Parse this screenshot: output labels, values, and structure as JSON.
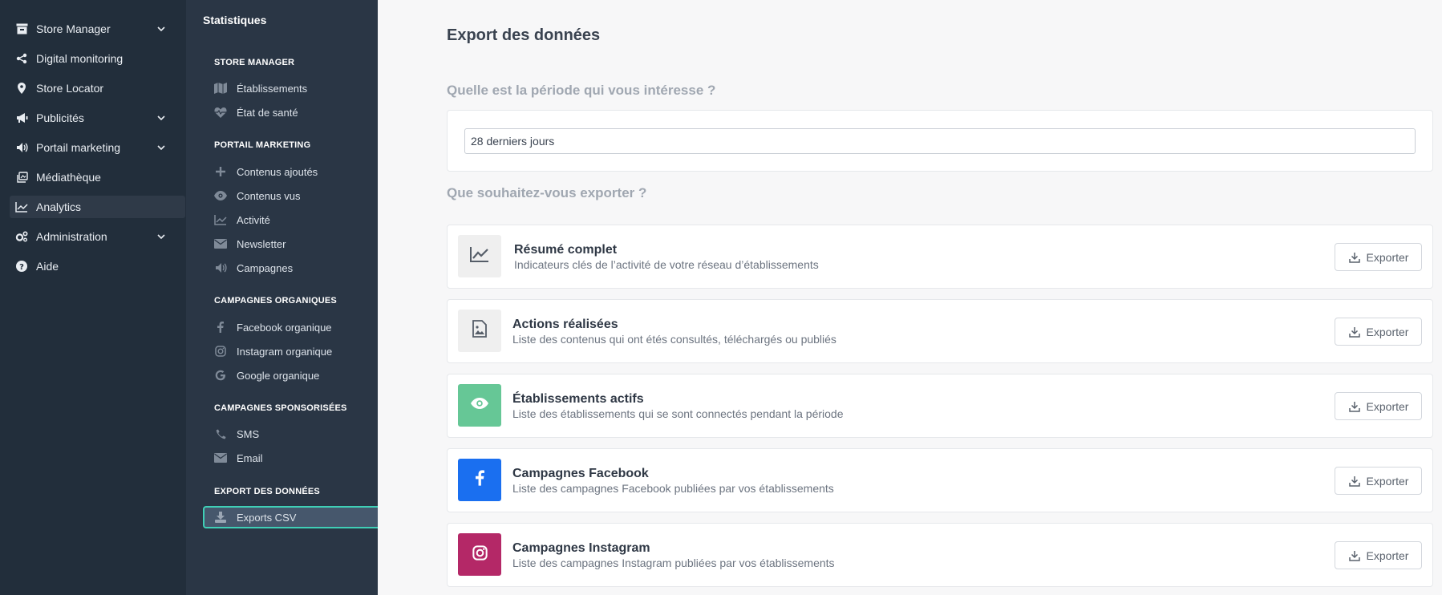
{
  "nav_main": {
    "items": [
      {
        "label": "Store Manager",
        "icon": "store-icon",
        "has_chevron": true
      },
      {
        "label": "Digital monitoring",
        "icon": "share-icon",
        "has_chevron": false
      },
      {
        "label": "Store Locator",
        "icon": "map-pin-icon",
        "has_chevron": false
      },
      {
        "label": "Publicités",
        "icon": "bullhorn-icon",
        "has_chevron": true
      },
      {
        "label": "Portail marketing",
        "icon": "volume-icon",
        "has_chevron": true
      },
      {
        "label": "Médiathèque",
        "icon": "media-icon",
        "has_chevron": false
      },
      {
        "label": "Analytics",
        "icon": "chart-line-icon",
        "has_chevron": false,
        "active": true
      },
      {
        "label": "Administration",
        "icon": "cogs-icon",
        "has_chevron": true
      },
      {
        "label": "Aide",
        "icon": "question-circle-icon",
        "has_chevron": false
      }
    ]
  },
  "nav_stats": {
    "title": "Statistiques",
    "sections": [
      {
        "label": "STORE MANAGER",
        "items": [
          {
            "label": "Établissements",
            "icon": "map-icon"
          },
          {
            "label": "État de santé",
            "icon": "heartbeat-icon"
          }
        ]
      },
      {
        "label": "PORTAIL MARKETING",
        "items": [
          {
            "label": "Contenus ajoutés",
            "icon": "plus-icon"
          },
          {
            "label": "Contenus vus",
            "icon": "eye-icon"
          },
          {
            "label": "Activité",
            "icon": "chart-line-icon"
          },
          {
            "label": "Newsletter",
            "icon": "envelope-icon"
          },
          {
            "label": "Campagnes",
            "icon": "volume-icon"
          }
        ]
      },
      {
        "label": "CAMPAGNES ORGANIQUES",
        "items": [
          {
            "label": "Facebook organique",
            "icon": "facebook-icon"
          },
          {
            "label": "Instagram organique",
            "icon": "instagram-icon"
          },
          {
            "label": "Google organique",
            "icon": "google-icon"
          }
        ]
      },
      {
        "label": "CAMPAGNES SPONSORISÉES",
        "items": [
          {
            "label": "SMS",
            "icon": "phone-icon"
          },
          {
            "label": "Email",
            "icon": "envelope-icon"
          }
        ]
      },
      {
        "label": "EXPORT DES DONNÉES",
        "items": [
          {
            "label": "Exports CSV",
            "icon": "download-icon",
            "active": true
          }
        ]
      }
    ]
  },
  "main": {
    "title": "Export des données",
    "period_question": "Quelle est la période qui vous intéresse ?",
    "period_value": "28 derniers jours",
    "export_question": "Que souhaitez-vous exporter ?",
    "export_button_label": "Exporter",
    "exports": [
      {
        "title": "Résumé complet",
        "description": "Indicateurs clés de l’activité de votre réseau d’établissements",
        "icon": "chart-line-icon",
        "color": "#efefef"
      },
      {
        "title": "Actions réalisées",
        "description": "Liste des contenus qui ont étés consultés, téléchargés ou publiés",
        "icon": "file-image-icon",
        "color": "#efefef"
      },
      {
        "title": "Établissements actifs",
        "description": "Liste des établissements qui se sont connectés pendant la période",
        "icon": "eye-icon",
        "color": "#66c796"
      },
      {
        "title": "Campagnes Facebook",
        "description": "Liste des campagnes Facebook publiées par vos établissements",
        "icon": "facebook-icon",
        "color": "#1a6ff0"
      },
      {
        "title": "Campagnes Instagram",
        "description": "Liste des campagnes Instagram publiées par vos établissements",
        "icon": "instagram-icon",
        "color": "#b42867"
      }
    ]
  },
  "colors": {
    "sidebar_main": "#222e3b",
    "sidebar_stats": "#2a3645",
    "accent_active": "#3fcfb6"
  }
}
